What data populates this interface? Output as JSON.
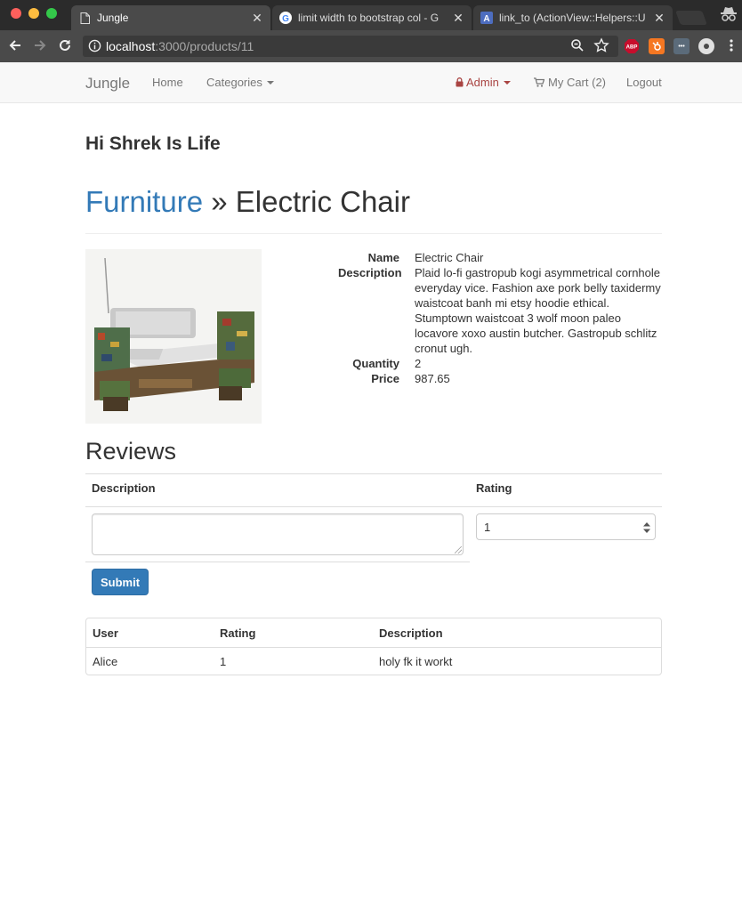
{
  "browser": {
    "tabs": [
      {
        "title": "Jungle",
        "active": true
      },
      {
        "title": "limit width to bootstrap col - G",
        "active": false
      },
      {
        "title": "link_to (ActionView::Helpers::U",
        "active": false
      }
    ],
    "url_host": "localhost",
    "url_path": ":3000/products/11",
    "extensions": [
      {
        "name": "adblock-plus-icon",
        "label": "ABP",
        "color": "#c70d2c"
      },
      {
        "name": "hubspot-icon",
        "label": "",
        "color": "#f57722"
      },
      {
        "name": "extension-dots-icon",
        "label": "•••",
        "color": "#5b6b7a"
      },
      {
        "name": "extension-circle-icon",
        "label": "",
        "color": "#e0e0e0"
      }
    ]
  },
  "navbar": {
    "brand": "Jungle",
    "home": "Home",
    "categories": "Categories",
    "admin": "Admin",
    "cart": "My Cart (2)",
    "logout": "Logout"
  },
  "greeting": "Hi Shrek Is Life",
  "header": {
    "category": "Furniture",
    "separator": " » ",
    "product": "Electric Chair"
  },
  "product": {
    "name_label": "Name",
    "name": "Electric Chair",
    "description_label": "Description",
    "description": "Plaid lo-fi gastropub kogi asymmetrical cornhole everyday vice. Fashion axe pork belly taxidermy waistcoat banh mi etsy hoodie ethical. Stumptown waistcoat 3 wolf moon paleo locavore xoxo austin butcher. Gastropub schlitz cronut ugh.",
    "quantity_label": "Quantity",
    "quantity": "2",
    "price_label": "Price",
    "price": "987.65"
  },
  "reviews": {
    "title": "Reviews",
    "form": {
      "description_header": "Description",
      "rating_header": "Rating",
      "rating_selected": "1",
      "submit": "Submit"
    },
    "table": {
      "headers": [
        "User",
        "Rating",
        "Description"
      ],
      "rows": [
        [
          "Alice",
          "1",
          "holy fk it workt"
        ]
      ]
    }
  }
}
